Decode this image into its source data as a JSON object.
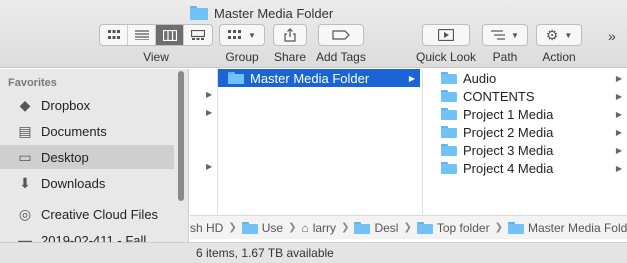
{
  "window": {
    "title": "Master Media Folder"
  },
  "toolbar": {
    "view_label": "View",
    "group_label": "Group",
    "share_label": "Share",
    "tags_label": "Add Tags",
    "quicklook_label": "Quick Look",
    "path_label": "Path",
    "action_label": "Action",
    "overflow_glyph": "»"
  },
  "sidebar": {
    "heading": "Favorites",
    "items": [
      {
        "label": "Dropbox",
        "icon": "dropbox-icon",
        "glyph": "◆"
      },
      {
        "label": "Documents",
        "icon": "document-icon",
        "glyph": "▤"
      },
      {
        "label": "Desktop",
        "icon": "desktop-icon",
        "glyph": "▭"
      },
      {
        "label": "Downloads",
        "icon": "download-icon",
        "glyph": "⬇"
      },
      {
        "label": "Creative Cloud Files",
        "icon": "creative-cloud-icon",
        "glyph": "◎"
      },
      {
        "label": "2019-02-411 - Fall",
        "icon": "folder-icon",
        "glyph": "▬"
      }
    ]
  },
  "browser": {
    "column2": {
      "selected": "Master Media Folder"
    },
    "column3": {
      "items": [
        "Audio",
        "CONTENTS",
        "Project 1 Media",
        "Project 2 Media",
        "Project 3 Media",
        "Project 4 Media"
      ]
    }
  },
  "pathbar": {
    "segments": [
      {
        "label": "sh HD",
        "icon": "disk-icon",
        "glyph": ""
      },
      {
        "label": "Use",
        "icon": "folder-icon",
        "glyph": ""
      },
      {
        "label": "larry",
        "icon": "home-icon",
        "glyph": "⌂"
      },
      {
        "label": "Desl",
        "icon": "folder-icon",
        "glyph": ""
      },
      {
        "label": "Top folder",
        "icon": "folder-icon",
        "glyph": ""
      },
      {
        "label": "Master Media Folder",
        "icon": "folder-icon",
        "glyph": ""
      }
    ]
  },
  "status": {
    "text": "6 items, 1.67 TB available"
  }
}
